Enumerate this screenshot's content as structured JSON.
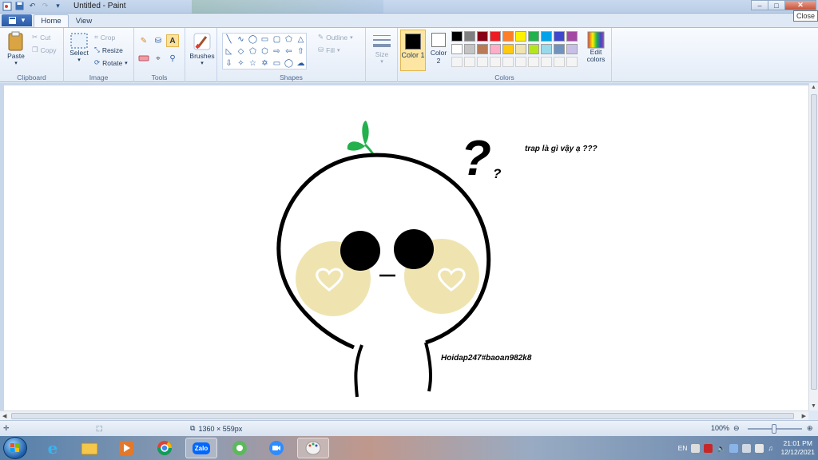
{
  "window": {
    "title": "Untitled - Paint",
    "tooltip": "Close",
    "buttons": {
      "minimize": "–",
      "maximize": "□",
      "close": "✕"
    }
  },
  "ribbon": {
    "tabs": [
      {
        "label": "Home"
      },
      {
        "label": "View"
      }
    ],
    "clipboard": {
      "paste": "Paste",
      "cut": "Cut",
      "copy": "Copy",
      "group": "Clipboard"
    },
    "image": {
      "select": "Select",
      "crop": "Crop",
      "resize": "Resize",
      "rotate": "Rotate",
      "group": "Image"
    },
    "tools": {
      "group": "Tools"
    },
    "brushes": {
      "label": "Brushes"
    },
    "shapes": {
      "outline": "Outline",
      "fill": "Fill",
      "group": "Shapes"
    },
    "size": {
      "label": "Size"
    },
    "colors": {
      "color1": "Color 1",
      "color2": "Color 2",
      "edit": "Edit colors",
      "group": "Colors",
      "color1_value": "#000000",
      "color2_value": "#ffffff",
      "palette_row1": [
        "#000000",
        "#7f7f7f",
        "#880015",
        "#ed1c24",
        "#ff7f27",
        "#fff200",
        "#22b14c",
        "#00a2e8",
        "#3f48cc",
        "#a349a4"
      ],
      "palette_row2": [
        "#ffffff",
        "#c3c3c3",
        "#b97a57",
        "#ffaec9",
        "#ffc90e",
        "#efe4b0",
        "#b5e61d",
        "#99d9ea",
        "#7092be",
        "#c8bfe7"
      ]
    }
  },
  "canvas": {
    "question_big": "?",
    "question_small": "?",
    "caption": "trap là gì vậy ạ ???",
    "signature": "Hoidap247#baoan982k8",
    "cheek_color": "#efe4b0",
    "sprout_color": "#22b14c"
  },
  "statusbar": {
    "dimensions": "1360 × 559px",
    "zoom": "100%"
  },
  "taskbar": {
    "apps": [
      "Start",
      "Internet Explorer",
      "File Explorer",
      "Media",
      "Chrome",
      "Zalo",
      "Coc Coc",
      "Zoom",
      "Paint"
    ],
    "zalo_label": "Zalo",
    "language": "EN",
    "time": "21:01 PM",
    "date": "12/12/2021"
  }
}
